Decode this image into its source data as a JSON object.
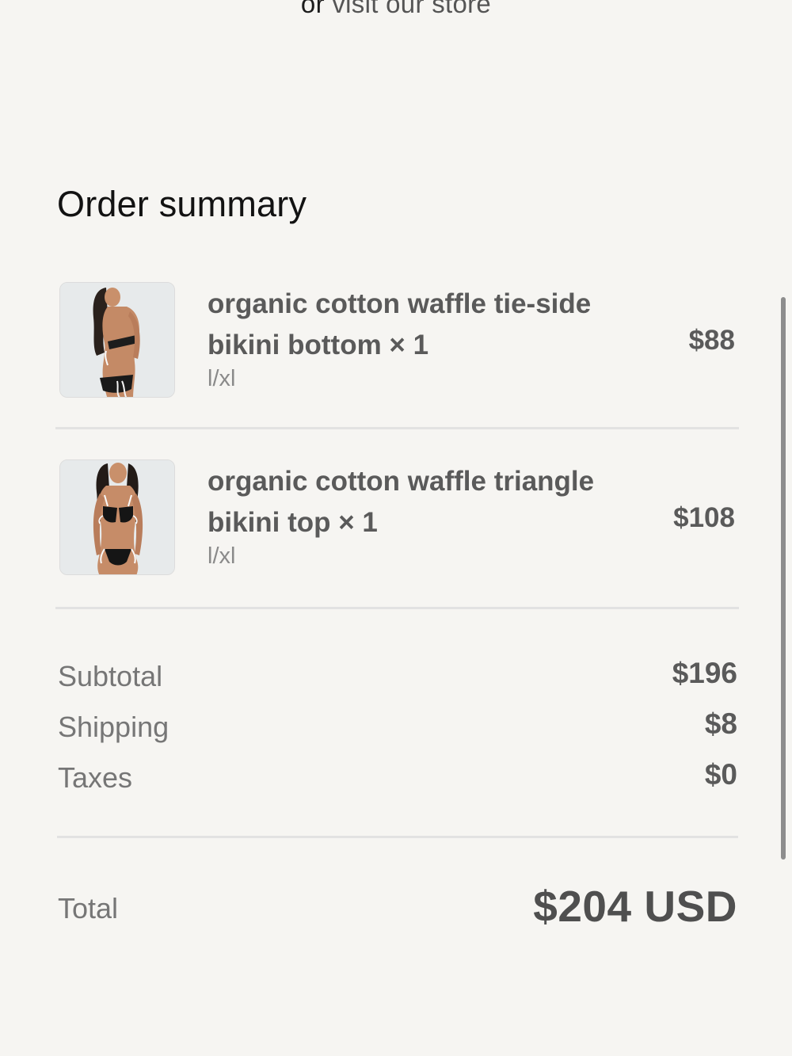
{
  "header": {
    "prefix": "or",
    "link_text": "visit our store"
  },
  "summary": {
    "title": "Order summary"
  },
  "items": [
    {
      "name": "organic cotton waffle tie-side bikini bottom × 1",
      "variant": "l/xl",
      "price": "$88",
      "image_icon": "product-photo-bikini-bottom"
    },
    {
      "name": "organic cotton waffle triangle bikini top × 1",
      "variant": "l/xl",
      "price": "$108",
      "image_icon": "product-photo-bikini-top"
    }
  ],
  "totals": {
    "subtotal_label": "Subtotal",
    "subtotal_value": "$196",
    "shipping_label": "Shipping",
    "shipping_value": "$8",
    "taxes_label": "Taxes",
    "taxes_value": "$0",
    "total_label": "Total",
    "total_value": "$204 USD"
  },
  "colors": {
    "background": "#f6f5f2",
    "text_primary": "#121212",
    "text_muted": "#767676",
    "divider": "#e2e2e2"
  }
}
